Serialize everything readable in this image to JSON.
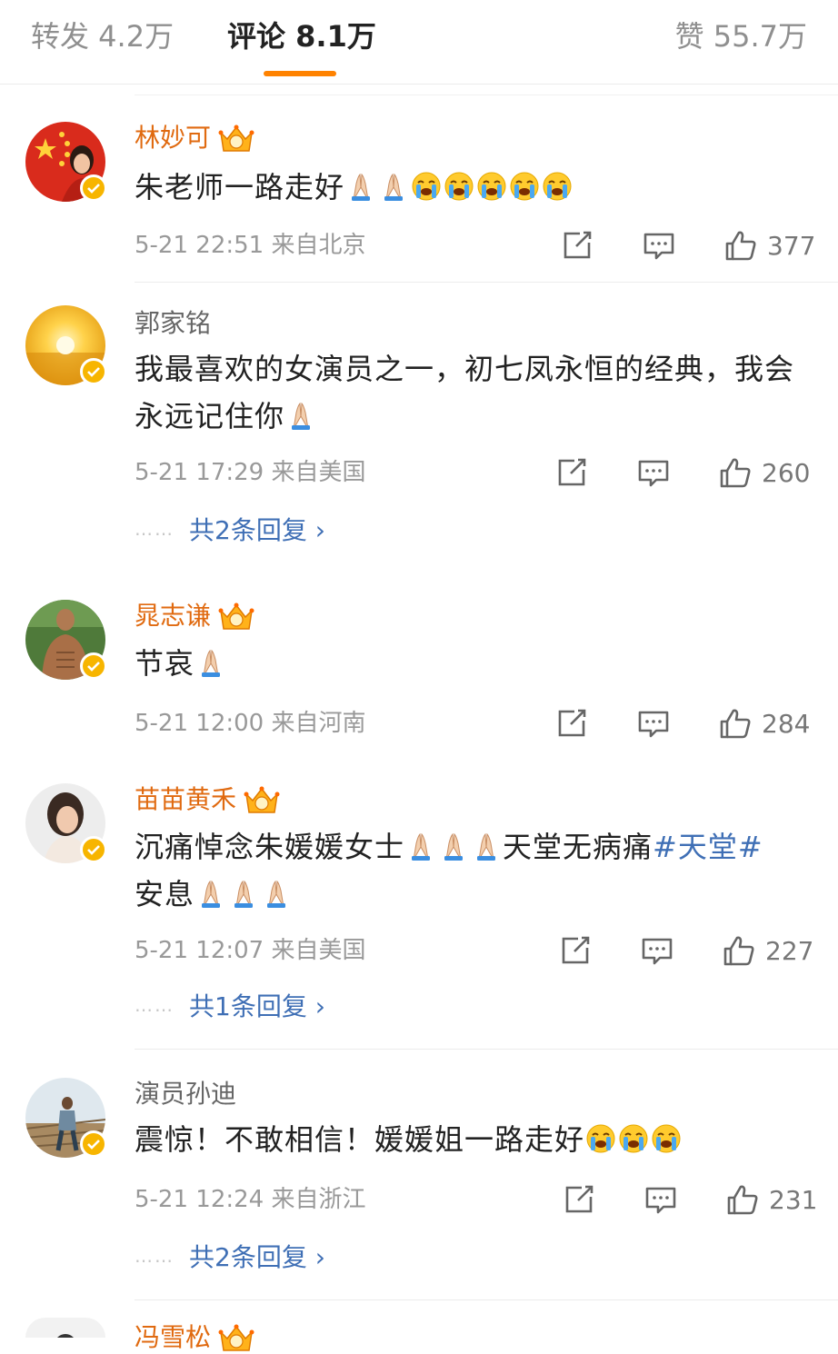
{
  "tabs": {
    "repost": "转发 4.2万",
    "comment": "评论 8.1万",
    "like": "赞 55.7万"
  },
  "colors": {
    "accent": "#ff8200",
    "link": "#3f6fb5",
    "vip_name": "#e06a10",
    "verified": "#f7b500"
  },
  "comments": [
    {
      "name": "林妙可",
      "vip": true,
      "text": "朱老师一路走好",
      "emoji": [
        "pray-emoji",
        "pray-emoji",
        "crying-emoji",
        "crying-emoji",
        "crying-emoji",
        "crying-emoji",
        "crying-emoji"
      ],
      "time": "5-21 22:51",
      "location": "来自北京",
      "likes": "377"
    },
    {
      "name": "郭家铭",
      "vip": false,
      "text": "我最喜欢的女演员之一，初七凤永恒的经典，我会永远记住你",
      "emoji": [
        "pray-emoji"
      ],
      "time": "5-21 17:29",
      "location": "来自美国",
      "likes": "260",
      "replies": "共2条回复 ›"
    },
    {
      "name": "晁志谦",
      "vip": true,
      "text": "节哀",
      "emoji": [
        "pray-emoji"
      ],
      "time": "5-21 12:00",
      "location": "来自河南",
      "likes": "284"
    },
    {
      "name": "苗苗黄禾",
      "vip": true,
      "text_a": "沉痛悼念朱媛媛女士",
      "text_b": "天堂无病痛",
      "hashtag": "#天堂#",
      "text_c": "安息",
      "time": "5-21 12:07",
      "location": "来自美国",
      "likes": "227",
      "replies": "共1条回复 ›"
    },
    {
      "name": "演员孙迪",
      "vip": false,
      "text": "震惊！不敢相信！媛媛姐一路走好",
      "emoji": [
        "crying-emoji",
        "crying-emoji",
        "crying-emoji"
      ],
      "time": "5-21 12:24",
      "location": "来自浙江",
      "likes": "231",
      "replies": "共2条回复 ›"
    }
  ],
  "partial_next": {
    "name": "冯雪松"
  }
}
